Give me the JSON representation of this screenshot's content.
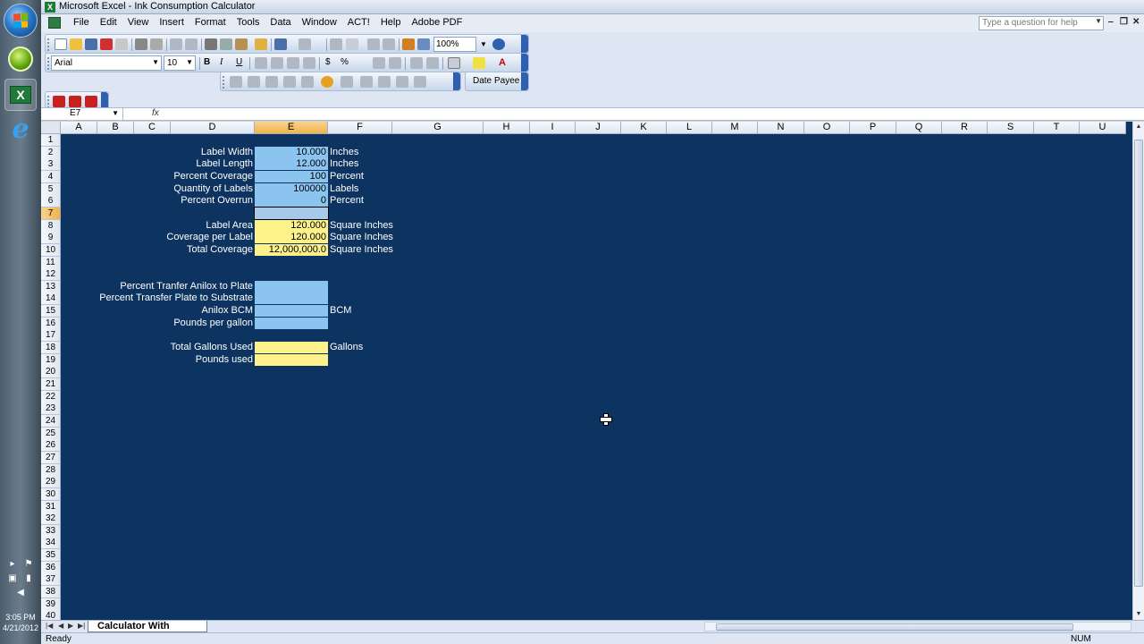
{
  "window": {
    "title": "Microsoft Excel - Ink Consumption Calculator",
    "min": "‒",
    "restore": "❐",
    "close": "✕"
  },
  "taskbar": {
    "time": "3:05 PM",
    "date": "4/21/2012",
    "excel_glyph": "X",
    "ie_glyph": "e",
    "tray_chevron": "▸"
  },
  "menu": {
    "items": [
      "File",
      "Edit",
      "View",
      "Insert",
      "Format",
      "Tools",
      "Data",
      "Window",
      "ACT!",
      "Help",
      "Adobe PDF"
    ],
    "help_placeholder": "Type a question for help"
  },
  "toolbar": {
    "zoom": "100%",
    "font_name": "Arial",
    "font_size": "10",
    "bold": "B",
    "italic": "I",
    "underline": "U",
    "currency": "$",
    "percent": "%",
    "date_btn": "Date",
    "payee_btn": "Payee"
  },
  "formula_bar": {
    "name_box": "E7",
    "fx": "fx"
  },
  "columns": [
    "A",
    "B",
    "C",
    "D",
    "E",
    "F",
    "G",
    "H",
    "I",
    "J",
    "K",
    "L",
    "M",
    "N",
    "O",
    "P",
    "Q",
    "R",
    "S",
    "T",
    "U"
  ],
  "selected_column": "E",
  "selected_row": 7,
  "rows": [
    "1",
    "2",
    "3",
    "4",
    "5",
    "6",
    "7",
    "8",
    "9",
    "10",
    "11",
    "12",
    "13",
    "14",
    "15",
    "16",
    "17",
    "18",
    "19",
    "20",
    "21",
    "22",
    "23",
    "24",
    "25",
    "26",
    "27",
    "28",
    "29",
    "30",
    "31",
    "32",
    "33",
    "34",
    "35",
    "36",
    "37",
    "38",
    "39",
    "40"
  ],
  "cells": {
    "r2": {
      "label": "Label Width",
      "value": "10.000",
      "unit": "Inches"
    },
    "r3": {
      "label": "Label Length",
      "value": "12.000",
      "unit": "Inches"
    },
    "r4": {
      "label": "Percent Coverage",
      "value": "100",
      "unit": "Percent"
    },
    "r5": {
      "label": "Quantity of Labels",
      "value": "100000",
      "unit": "Labels"
    },
    "r6": {
      "label": "Percent Overrun",
      "value": "0",
      "unit": "Percent"
    },
    "r8": {
      "label": "Label Area",
      "value": "120.000",
      "unit": "Square Inches"
    },
    "r9": {
      "label": "Coverage per Label",
      "value": "120.000",
      "unit": "Square Inches"
    },
    "r10": {
      "label": "Total Coverage",
      "value": "12,000,000.0",
      "unit": "Square Inches"
    },
    "r13": {
      "label": "Percent Tranfer Anilox to Plate",
      "value": "",
      "unit": ""
    },
    "r14": {
      "label": "Percent Transfer Plate to Substrate",
      "value": "",
      "unit": ""
    },
    "r15": {
      "label": "Anilox BCM",
      "value": "",
      "unit": "BCM"
    },
    "r16": {
      "label": "Pounds per gallon",
      "value": "",
      "unit": ""
    },
    "r18": {
      "label": "Total Gallons Used",
      "value": "",
      "unit": "Gallons"
    },
    "r19": {
      "label": "Pounds used",
      "value": "",
      "unit": ""
    }
  },
  "sheet_tab": "Calculator With Pounds",
  "status": {
    "left": "Ready",
    "num": "NUM"
  },
  "colors": {
    "sheet_bg": "#0d3460",
    "input_fill": "#8cc4f0",
    "output_fill": "#fdf28a"
  }
}
